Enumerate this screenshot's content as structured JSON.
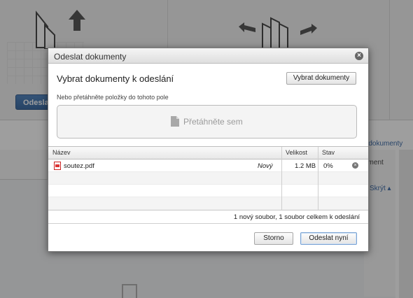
{
  "background": {
    "upload_button_label": "Odesla",
    "link_text": "é dokumenty",
    "side_text": "ument",
    "collapse_link": "Skrýt"
  },
  "dialog": {
    "title": "Odeslat dokumenty",
    "section_title": "Vybrat dokumenty k odeslání",
    "select_button": "Vybrat dokumenty",
    "hint": "Nebo přetáhněte položky do tohoto pole",
    "dropzone_label": "Přetáhněte sem",
    "table": {
      "headers": {
        "name": "Název",
        "size": "Velikost",
        "status": "Stav"
      },
      "rows": [
        {
          "name": "soutez.pdf",
          "flag": "Nový",
          "size": "1.2 MB",
          "status": "0%"
        }
      ]
    },
    "summary": "1 nový soubor, 1 soubor celkem k odeslání",
    "cancel_button": "Storno",
    "send_button": "Odeslat nyní"
  }
}
